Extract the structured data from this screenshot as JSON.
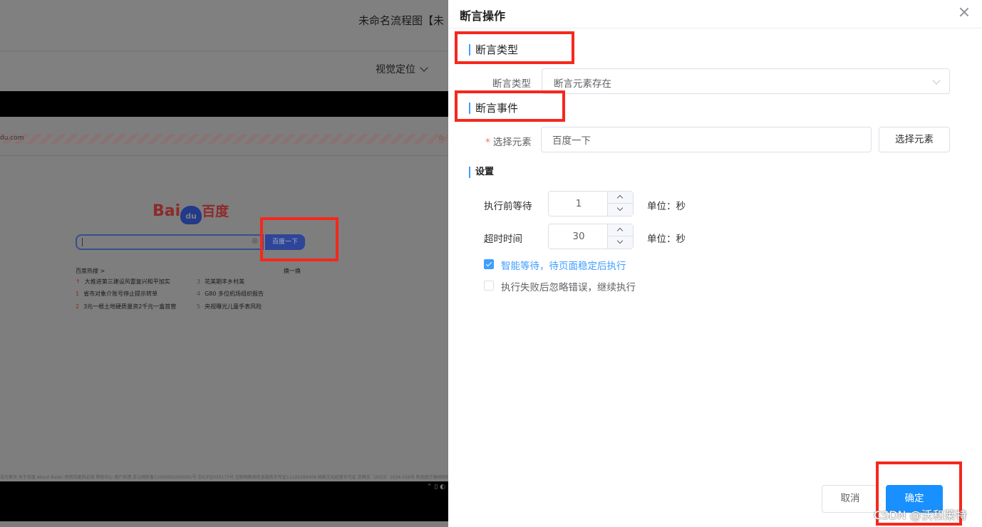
{
  "background": {
    "app_title": "未命名流程图【未",
    "visual_locate_label": "视觉定位",
    "url_text": "du.com",
    "baidu_logo_bai": "Bai",
    "baidu_logo_du": "du",
    "baidu_logo_cn": "百度",
    "baidu_search_button": "百度一下",
    "hot_search_title": "百度热搜 >",
    "hot_search_swap": "换一换",
    "hot_items": [
      {
        "n": "↑",
        "text": "大推进第三建设风雷复兴和平加实"
      },
      {
        "n": "3",
        "text": "花美期丰乡村美"
      },
      {
        "n": "1",
        "text": "省市对象介账号停止提示转单"
      },
      {
        "n": "4",
        "text": "G80 多位机场组织报告"
      },
      {
        "n": "2",
        "text": "3元一根土地硬质量资2千元一盒首营"
      },
      {
        "n": "5",
        "text": "央视曝光儿童手表风险"
      }
    ],
    "footer_text": "设为首页   关于百度   About Baidu   使用百度前必读   帮助中心   用户反馈   京公网安备11000002000001号   京ICP证030173号   互联网新闻信息服务许可证11220180008   网络文化经营许可证 京网文〔2023〕1034-029号   药品医疗器械网络信息服务备案（京）网药械信息备字（2021）第00159号"
  },
  "drawer": {
    "title": "断言操作",
    "assert_type_section": "断言类型",
    "assert_type_label": "断言类型",
    "assert_type_value": "断言元素存在",
    "assert_event_section": "断言事件",
    "select_element_label": "选择元素",
    "select_element_value": "百度一下",
    "select_element_button": "选择元素",
    "settings_section": "设置",
    "wait_before_label": "执行前等待",
    "wait_before_value": "1",
    "wait_before_unit": "单位：秒",
    "timeout_label": "超时时间",
    "timeout_value": "30",
    "timeout_unit": "单位：秒",
    "smart_wait_label": "智能等待，待页面稳定后执行",
    "smart_wait_checked": true,
    "ignore_error_label": "执行失败后忽略错误，继续执行",
    "ignore_error_checked": false,
    "cancel_button": "取消",
    "confirm_button": "确定"
  },
  "watermark": "CSDN @沃和莱特",
  "colors": {
    "primary": "#1890ff",
    "accent_blue": "#409eff",
    "highlight_red": "#f5281c",
    "required_red": "#f56c6c"
  }
}
